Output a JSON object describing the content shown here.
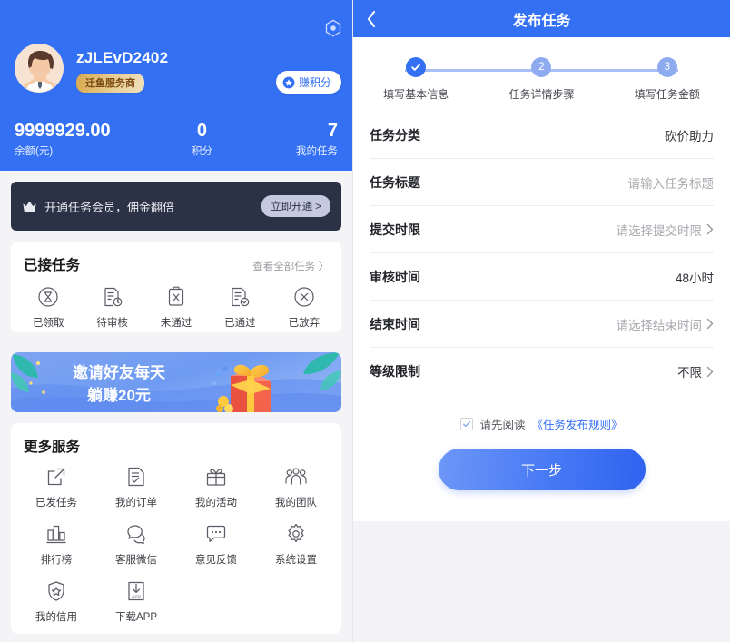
{
  "left": {
    "gear_icon": "hexagon-gear-icon",
    "profile": {
      "username": "zJLEvD2402",
      "role_badge": "迁鱼服务商",
      "earn_points_label": "赚积分",
      "earn_points_icon": "star-circle-icon",
      "avatar_icon": "user-avatar"
    },
    "stats": [
      {
        "value": "9999929.00",
        "label": "余额(元)"
      },
      {
        "value": "0",
        "label": "积分"
      },
      {
        "value": "7",
        "label": "我的任务"
      }
    ],
    "vip_banner": {
      "icon": "crown-icon",
      "text": "开通任务会员，佣金翻倍",
      "button": "立即开通 >"
    },
    "accepted": {
      "title": "已接任务",
      "see_all": "查看全部任务 〉",
      "items": [
        {
          "label": "已领取",
          "icon": "hourglass-circle-icon"
        },
        {
          "label": "待审核",
          "icon": "document-clock-icon"
        },
        {
          "label": "未通过",
          "icon": "clipboard-x-icon"
        },
        {
          "label": "已通过",
          "icon": "document-check-icon"
        },
        {
          "label": "已放弃",
          "icon": "x-circle-icon"
        }
      ]
    },
    "invite_banner": {
      "line1": "邀请好友每天",
      "line2": "躺赚20元",
      "icon": "gift-box-icon"
    },
    "services": {
      "title": "更多服务",
      "items": [
        {
          "label": "已发任务",
          "icon": "external-link-icon"
        },
        {
          "label": "我的订单",
          "icon": "order-list-icon"
        },
        {
          "label": "我的活动",
          "icon": "gift-icon"
        },
        {
          "label": "我的团队",
          "icon": "users-group-icon"
        },
        {
          "label": "排行榜",
          "icon": "bar-chart-icon"
        },
        {
          "label": "客服微信",
          "icon": "chat-bubbles-icon"
        },
        {
          "label": "意见反馈",
          "icon": "feedback-bubble-icon"
        },
        {
          "label": "系统设置",
          "icon": "gear-icon"
        },
        {
          "label": "我的信用",
          "icon": "shield-star-icon"
        },
        {
          "label": "下载APP",
          "icon": "download-app-icon"
        }
      ]
    }
  },
  "right": {
    "header": {
      "title": "发布任务",
      "back_icon": "chevron-left-icon"
    },
    "stepper": [
      {
        "num": "✓",
        "label": "填写基本信息",
        "state": "done"
      },
      {
        "num": "2",
        "label": "任务详情步骤",
        "state": "pending"
      },
      {
        "num": "3",
        "label": "填写任务金额",
        "state": "pending"
      }
    ],
    "form": [
      {
        "label": "任务分类",
        "value": "砍价助力",
        "placeholder": false,
        "chevron": false
      },
      {
        "label": "任务标题",
        "value": "请输入任务标题",
        "placeholder": true,
        "chevron": false
      },
      {
        "label": "提交时限",
        "value": "请选择提交时限",
        "placeholder": true,
        "chevron": true
      },
      {
        "label": "审核时间",
        "value": "48小时",
        "placeholder": false,
        "chevron": false
      },
      {
        "label": "结束时间",
        "value": "请选择结束时间",
        "placeholder": true,
        "chevron": true
      },
      {
        "label": "等级限制",
        "value": "不限",
        "placeholder": false,
        "chevron": true
      }
    ],
    "agreement": {
      "prefix": "请先阅读",
      "link": "《任务发布规则》",
      "checked": true
    },
    "next_button": "下一步"
  },
  "colors": {
    "brand_blue": "#3470f4",
    "step_pending": "#8eabef",
    "vip_dark": "#2b3245",
    "badge_gold": "#d9a84f",
    "page_bg": "#f4f4f6"
  }
}
